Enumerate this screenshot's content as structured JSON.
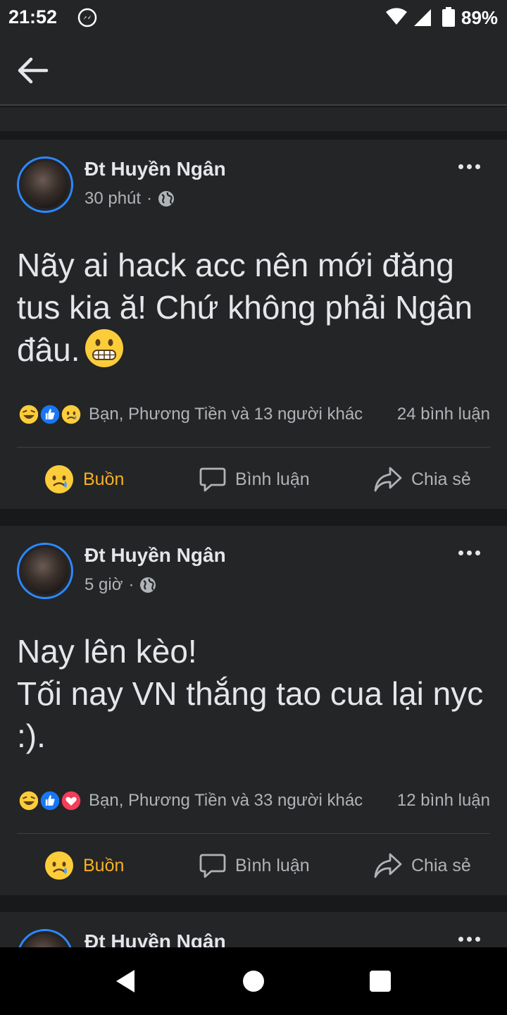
{
  "status_bar": {
    "time": "21:52",
    "battery": "89%"
  },
  "posts": [
    {
      "author": "Đt Huyền Ngân",
      "time": "30 phút",
      "separator": "·",
      "text": "Nãy ai hack acc nên mới đăng tus kia ă! Chứ không phải Ngân đâu.",
      "inline_emoji": "grimacing-face",
      "reaction_icons": [
        "haha",
        "like",
        "sad"
      ],
      "reactions_text": "Bạn, Phương Tiền và 13 người khác",
      "comments": "24 bình luận",
      "actions": {
        "react": "Buồn",
        "comment": "Bình luận",
        "share": "Chia sẻ"
      }
    },
    {
      "author": "Đt Huyền Ngân",
      "time": "5 giờ",
      "separator": "·",
      "text": "Nay lên kèo!\nTối nay VN thắng tao cua lại nyc :).",
      "reaction_icons": [
        "haha",
        "like",
        "love"
      ],
      "reactions_text": "Bạn, Phương Tiền và 33 người khác",
      "comments": "12 bình luận",
      "actions": {
        "react": "Buồn",
        "comment": "Bình luận",
        "share": "Chia sẻ"
      }
    },
    {
      "author": "Đt Huyền Ngân"
    }
  ],
  "colors": {
    "accent": "#2d88ff",
    "sad": "#f7b125",
    "background": "#242526",
    "gap": "#18191a"
  }
}
